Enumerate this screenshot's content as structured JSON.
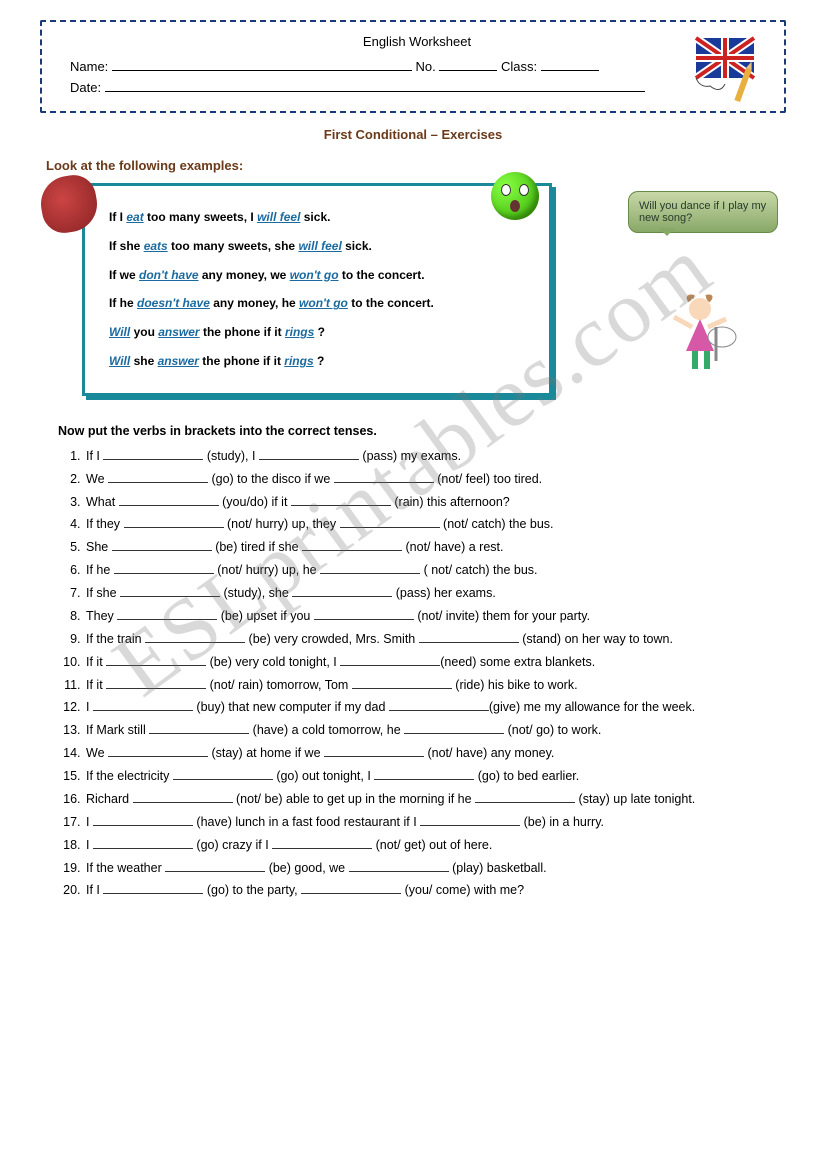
{
  "watermark": "ESLprintables.com",
  "header": {
    "title": "English Worksheet",
    "name_label": "Name:",
    "no_label": "No.",
    "class_label": "Class:",
    "date_label": "Date:"
  },
  "section_title": "First Conditional – Exercises",
  "examples_intro": "Look at the following examples:",
  "examples": [
    {
      "pre": "If I ",
      "k1": "eat",
      "mid": " too many sweets, I ",
      "k2": "will feel",
      "post": " sick."
    },
    {
      "pre": "If she ",
      "k1": "eats",
      "mid": " too many sweets, she ",
      "k2": "will feel",
      "post": " sick."
    },
    {
      "pre": "If we ",
      "k1": "don't have",
      "mid": " any money, we ",
      "k2": "won't go",
      "post": " to the concert."
    },
    {
      "pre": "If he ",
      "k1": "doesn't have",
      "mid": " any money, he ",
      "k2": "won't go",
      "post": " to the concert."
    },
    {
      "k1": "Will",
      "mid1": " you ",
      "k2": "answer",
      "mid2": " the phone if it ",
      "k3": "rings",
      "post": " ?"
    },
    {
      "k1": "Will",
      "mid1": " she ",
      "k2": "answer",
      "mid2": " the phone if it ",
      "k3": "rings",
      "post": " ?"
    }
  ],
  "bubble_text": "Will you dance if I play my new song?",
  "instruction": "Now put the verbs in brackets into the correct tenses.",
  "items": [
    {
      "p": [
        "If I ",
        " (study), I ",
        " (pass) my exams."
      ]
    },
    {
      "p": [
        "We ",
        " (go) to the disco if we ",
        " (not/ feel) too tired."
      ]
    },
    {
      "p": [
        "What ",
        " (you/do) if it ",
        " (rain) this afternoon?"
      ]
    },
    {
      "p": [
        "If they ",
        " (not/ hurry) up, they ",
        " (not/ catch) the bus."
      ]
    },
    {
      "p": [
        "She ",
        " (be) tired if she  ",
        " (not/ have) a rest."
      ]
    },
    {
      "p": [
        "If he ",
        " (not/ hurry) up, he ",
        " ( not/ catch) the bus."
      ]
    },
    {
      "p": [
        "If she ",
        " (study), she ",
        " (pass) her exams."
      ]
    },
    {
      "p": [
        "They ",
        " (be) upset if you ",
        " (not/ invite) them for your party."
      ]
    },
    {
      "p": [
        "If the train ",
        " (be) very crowded, Mrs. Smith ",
        " (stand) on her way to town."
      ]
    },
    {
      "p": [
        "If it ",
        " (be) very cold tonight, I ",
        "(need) some extra blankets."
      ]
    },
    {
      "p": [
        "If it ",
        " (not/ rain) tomorrow, Tom ",
        " (ride) his bike to work."
      ]
    },
    {
      "p": [
        "I ",
        " (buy) that new computer if my dad ",
        "(give) me my allowance for the week."
      ]
    },
    {
      "p": [
        "If Mark still ",
        " (have) a cold tomorrow, he ",
        " (not/ go) to work."
      ]
    },
    {
      "p": [
        "We ",
        " (stay) at home if we ",
        " (not/ have) any money."
      ]
    },
    {
      "p": [
        "If the electricity ",
        " (go) out tonight, I ",
        " (go) to bed earlier."
      ]
    },
    {
      "p": [
        "Richard ",
        " (not/ be) able to get up in the morning if he ",
        " (stay) up late tonight."
      ]
    },
    {
      "p": [
        "I ",
        " (have) lunch in a fast food restaurant if I ",
        " (be) in a hurry."
      ]
    },
    {
      "p": [
        "I ",
        " (go) crazy if I ",
        " (not/ get) out of here."
      ]
    },
    {
      "p": [
        "If the weather ",
        " (be) good, we ",
        " (play) basketball."
      ]
    },
    {
      "p": [
        "If I ",
        " (go) to the party, ",
        " (you/ come) with me?"
      ]
    }
  ]
}
